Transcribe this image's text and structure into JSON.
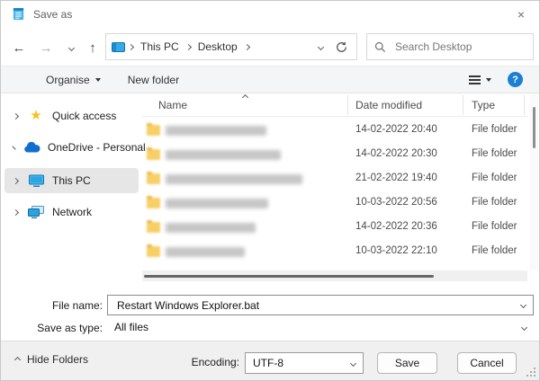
{
  "window": {
    "title": "Save as",
    "close_glyph": "×"
  },
  "nav": {
    "back_icon": "arrow-left",
    "forward_icon": "arrow-right",
    "recent_icon": "chevron-down",
    "up_icon": "arrow-up",
    "location_icon": "desktop-icon",
    "breadcrumb": [
      "This PC",
      "Desktop"
    ],
    "refresh_icon": "refresh",
    "search_placeholder": "Search Desktop"
  },
  "toolbar": {
    "organise_label": "Organise",
    "new_folder_label": "New folder",
    "views_icon": "list-view",
    "help_glyph": "?"
  },
  "sidebar": {
    "items": [
      {
        "label": "Quick access",
        "icon": "star",
        "selected": false
      },
      {
        "label": "OneDrive - Personal",
        "icon": "cloud",
        "selected": false
      },
      {
        "label": "This PC",
        "icon": "monitor",
        "selected": true
      },
      {
        "label": "Network",
        "icon": "network",
        "selected": false
      }
    ]
  },
  "filelist": {
    "columns": [
      "Name",
      "Date modified",
      "Type"
    ],
    "sort_column": "Name",
    "sort_direction": "asc",
    "rows": [
      {
        "name_redacted": true,
        "date": "14-02-2022 20:40",
        "type": "File folder",
        "blur_width": 112
      },
      {
        "name_redacted": true,
        "date": "14-02-2022 20:30",
        "type": "File folder",
        "blur_width": 128
      },
      {
        "name_redacted": true,
        "date": "21-02-2022 19:40",
        "type": "File folder",
        "blur_width": 152
      },
      {
        "name_redacted": true,
        "date": "10-03-2022 20:56",
        "type": "File folder",
        "blur_width": 114
      },
      {
        "name_redacted": true,
        "date": "14-02-2022 20:36",
        "type": "File folder",
        "blur_width": 100
      },
      {
        "name_redacted": true,
        "date": "10-03-2022 22:10",
        "type": "File folder",
        "blur_width": 88
      }
    ]
  },
  "fields": {
    "file_name_label": "File name:",
    "file_name_value": "Restart Windows Explorer.bat",
    "save_as_type_label": "Save as type:",
    "save_as_type_value": "All files"
  },
  "footer": {
    "hide_folders_label": "Hide Folders",
    "encoding_label": "Encoding:",
    "encoding_value": "UTF-8",
    "save_label": "Save",
    "cancel_label": "Cancel"
  },
  "colors": {
    "accent_blue": "#1c80d2",
    "folder_yellow": "#f7cf66",
    "selected_bg": "#e6e6e6",
    "toolbar_bg": "#f4f5f7",
    "footer_bg": "#f0f0f0"
  }
}
